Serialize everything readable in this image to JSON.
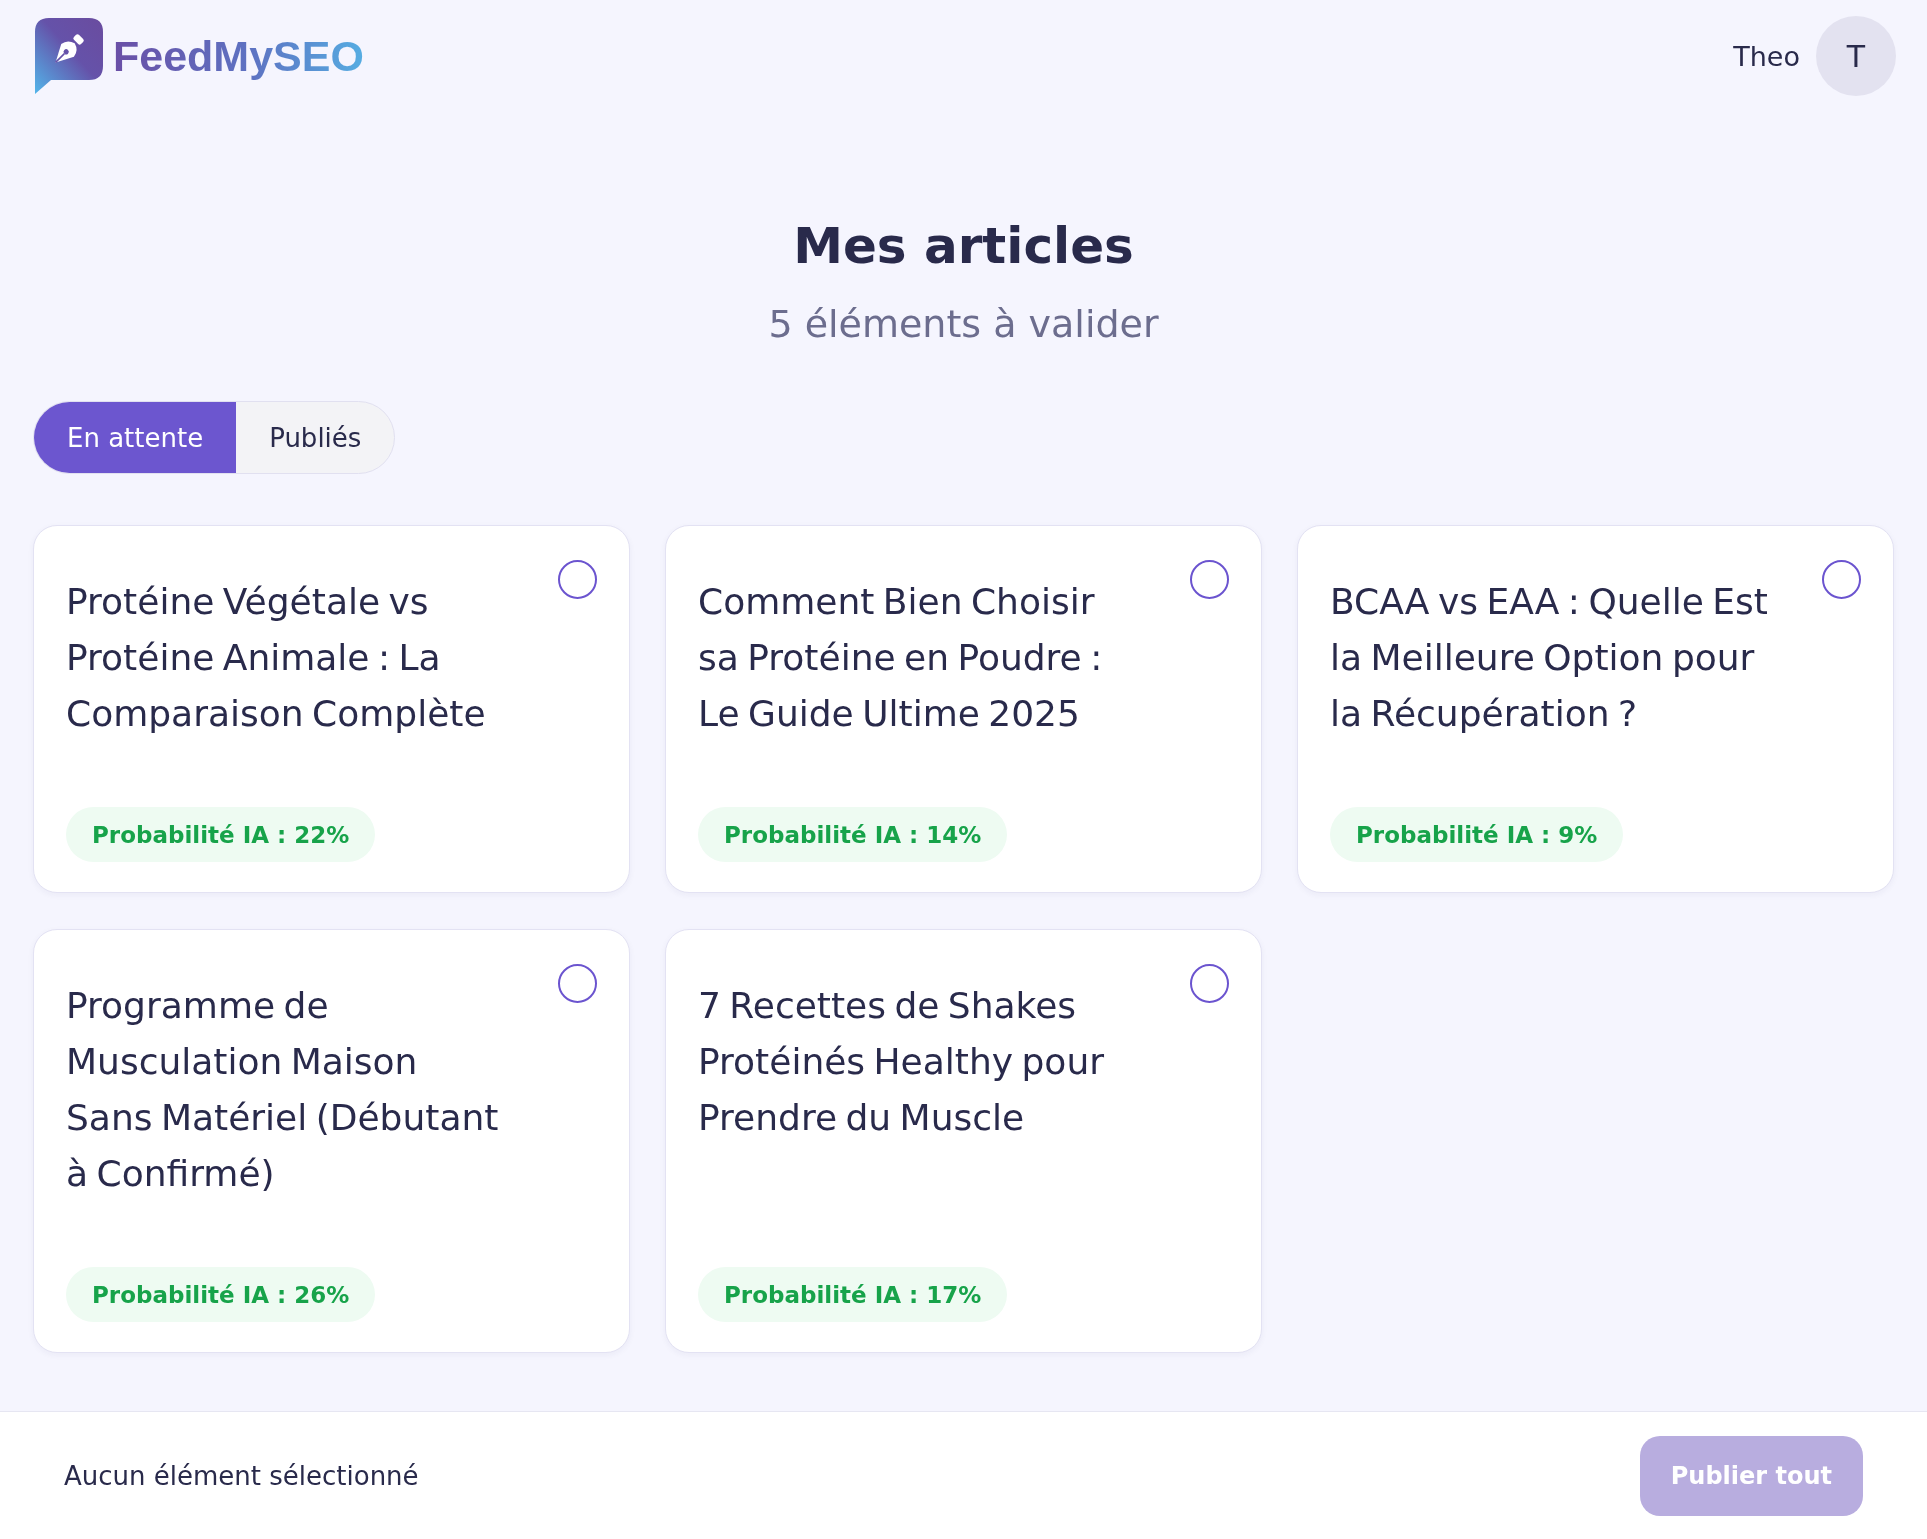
{
  "header": {
    "logo": {
      "text": "FeedMySEO"
    },
    "user": {
      "name": "Theo",
      "avatar_initial": "T"
    }
  },
  "page": {
    "title": "Mes articles",
    "subtitle": "5 éléments à valider"
  },
  "tabs": [
    {
      "label": "En attente",
      "selected": true
    },
    {
      "label": "Publiés",
      "selected": false
    }
  ],
  "articles": [
    {
      "title": "Protéine Végétale vs Protéine Animale : La Comparaison Complète",
      "badge": "Probabilité IA : 22%",
      "selected": false
    },
    {
      "title": "Comment Bien Choisir sa Protéine en Poudre : Le Guide Ultime 2025",
      "badge": "Probabilité IA : 14%",
      "selected": false
    },
    {
      "title": "BCAA vs EAA : Quelle Est la Meilleure Option pour la Récupération ?",
      "badge": "Probabilité IA : 9%",
      "selected": false
    },
    {
      "title": "Programme de Musculation Maison Sans Matériel (Débutant à Confirmé)",
      "badge": "Probabilité IA : 26%",
      "selected": false
    },
    {
      "title": "7 Recettes de Shakes Protéinés Healthy pour Prendre du Muscle",
      "badge": "Probabilité IA : 17%",
      "selected": false
    }
  ],
  "footer": {
    "status": "Aucun élément sélectionné",
    "publish_button": {
      "label": "Publier tout",
      "disabled": true
    }
  }
}
